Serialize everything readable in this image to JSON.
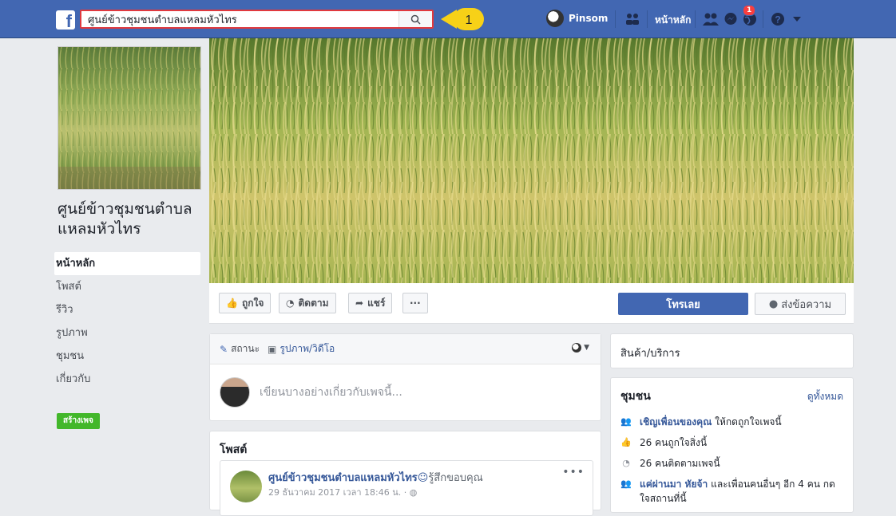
{
  "topbar": {
    "logo": "f",
    "search_value": "ศูนย์ข้าวชุมชนตำบลแหลมหัวไทร",
    "callout_number": "1",
    "user_name": "Pinsom",
    "home_label": "หน้าหลัก",
    "notification_count": "1"
  },
  "page": {
    "name": "ศูนย์ข้าวชุมชนตำบลแหลมหัวไทร",
    "nav": [
      {
        "label": "หน้าหลัก"
      },
      {
        "label": "โพสต์"
      },
      {
        "label": "รีวิว"
      },
      {
        "label": "รูปภาพ"
      },
      {
        "label": "ชุมชน"
      },
      {
        "label": "เกี่ยวกับ"
      }
    ],
    "create_page_label": "สร้างเพจ"
  },
  "actions": {
    "like_label": "ถูกใจ",
    "follow_label": "ติดตาม",
    "share_label": "แชร์",
    "more_label": "···",
    "call_label": "โทรเลย",
    "message_label": "ส่งข้อความ"
  },
  "composer": {
    "status_tab": "สถานะ",
    "photo_tab": "รูปภาพ/วิดีโอ",
    "placeholder": "เขียนบางอย่างเกี่ยวกับเพจนี้..."
  },
  "posts": {
    "title": "โพสต์",
    "first": {
      "author": "ศูนย์ข้าวชุมชนตำบลแหลมหัวไทร",
      "feeling": "รู้สึกขอบคุณ",
      "time": "29 ธันวาคม 2017 เวลา 18:46 น. · "
    }
  },
  "products": {
    "title": "สินค้า/บริการ"
  },
  "community": {
    "title": "ชุมชน",
    "see_all": "ดูทั้งหมด",
    "invite_link": "เชิญเพื่อนของคุณ",
    "invite_rest": " ให้กดถูกใจเพจนี้",
    "likes": "26 คนถูกใจสิ่งนี้",
    "follows": "26 คนติดตามเพจนี้",
    "friend_link": "แค่ผ่านมา หัยจ้า",
    "friend_rest": " และเพื่อนคนอื่นๆ อีก 4 คน กดใจสถานที่นี้"
  },
  "colors": {
    "brand": "#4267b2",
    "link": "#365899",
    "create_green": "#42b72a",
    "callout_yellow": "#f7d117",
    "search_highlight": "#e0393e"
  }
}
